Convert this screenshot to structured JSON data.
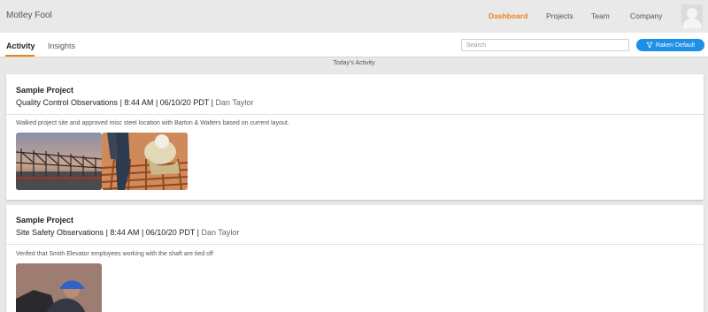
{
  "app": {
    "brand": "Motley Fool"
  },
  "nav": {
    "dashboard": "Dashboard",
    "projects": "Projects",
    "team": "Team",
    "company": "Company"
  },
  "tabs": {
    "activity": "Activity",
    "insights": "Insights"
  },
  "search": {
    "placeholder": "Search",
    "value": ""
  },
  "filter": {
    "label": "Raken Default",
    "icon": "funnel-icon"
  },
  "section": {
    "label": "Today's Activity"
  },
  "colors": {
    "accent": "#f0821e",
    "primary_button": "#1c8fe6"
  },
  "activities": [
    {
      "project": "Sample Project",
      "type": "Quality Control Observations",
      "time": "8:44 AM",
      "date": "06/10/20 PDT",
      "author": "Dan Taylor",
      "note": "Walked project site and approved misc steel location with Barton & Walters based on current layout.",
      "photos": [
        "steel-framing-photo",
        "workers-welding-photo"
      ]
    },
    {
      "project": "Sample Project",
      "type": "Site Safety Observations",
      "time": "8:44 AM",
      "date": "06/10/20 PDT",
      "author": "Dan Taylor",
      "note": "Verifed that Smith Elevator employees working with the shaft are tied off",
      "photos": [
        "worker-hard-hat-photo"
      ]
    }
  ]
}
